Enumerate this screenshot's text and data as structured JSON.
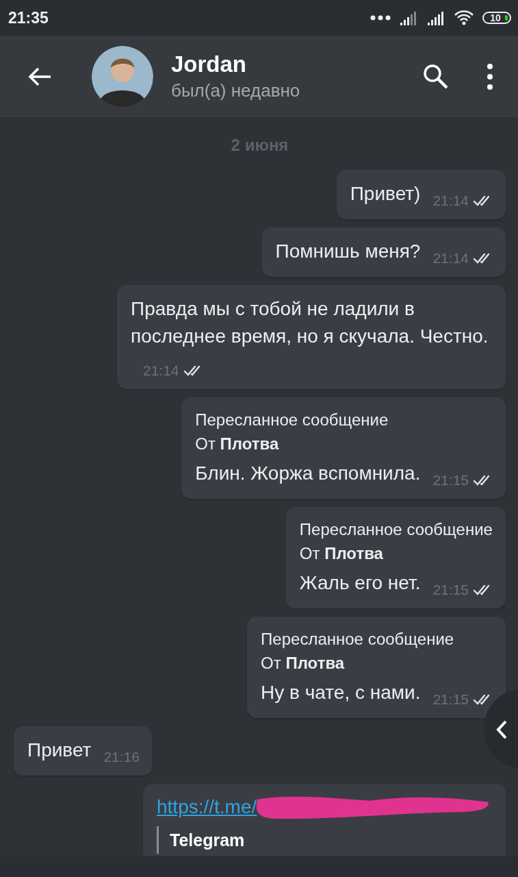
{
  "status_bar": {
    "time": "21:35",
    "battery": "10"
  },
  "header": {
    "name": "Jordan",
    "status": "был(а) недавно"
  },
  "date": "2 июня",
  "messages": [
    {
      "kind": "text",
      "outgoing": true,
      "text": "Привет)",
      "time": "21:14",
      "read": true
    },
    {
      "kind": "text",
      "outgoing": true,
      "text": "Помнишь меня?",
      "time": "21:14",
      "read": true
    },
    {
      "kind": "text",
      "outgoing": true,
      "text": "Правда мы с тобой не ладили в последнее время, но я скучала. Честно.",
      "time": "21:14",
      "read": true
    },
    {
      "kind": "forwarded",
      "outgoing": true,
      "forward_label": "Пересланное сообщение",
      "from": "От **Плотва**",
      "text": "Блин. Жоржа вспомнила.",
      "time": "21:15",
      "read": true
    },
    {
      "kind": "forwarded",
      "outgoing": true,
      "forward_label": "Пересланное сообщение",
      "from": "От **Плотва**",
      "text": "Жаль его нет.",
      "time": "21:15",
      "read": true
    },
    {
      "kind": "forwarded",
      "outgoing": true,
      "forward_label": "Пересланное сообщение",
      "from": "От **Плотва**",
      "text": "Ну в чате, с нами.",
      "time": "21:15",
      "read": true
    },
    {
      "kind": "text",
      "outgoing": false,
      "text": "Привет",
      "time": "21:16",
      "read": false
    },
    {
      "kind": "link",
      "outgoing": true,
      "url": "https://t.me/",
      "preview_title": "Telegram"
    }
  ]
}
